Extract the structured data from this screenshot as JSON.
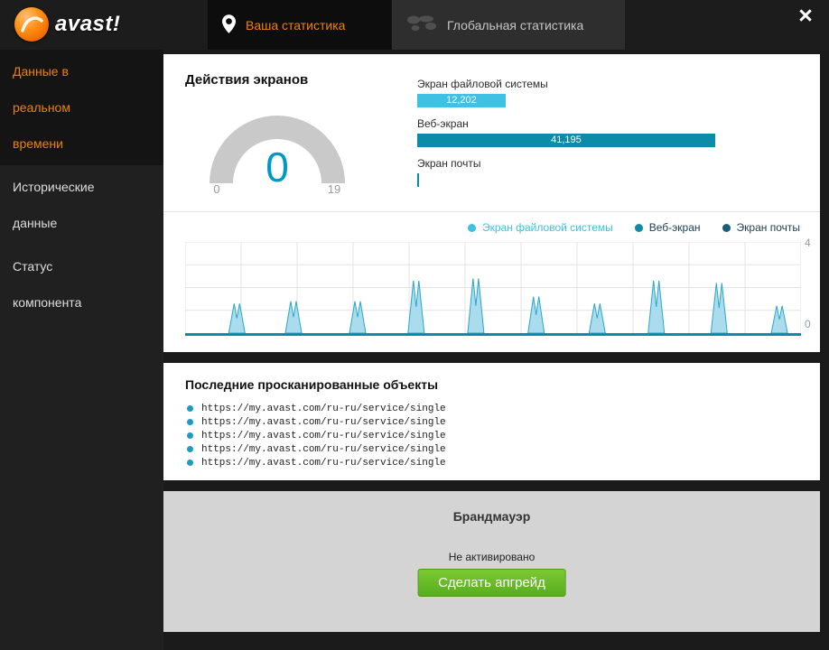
{
  "window": {
    "close": "×"
  },
  "logo": {
    "text": "avast!"
  },
  "tabs": [
    {
      "label": "Ваша статистика",
      "active": true
    },
    {
      "label": "Глобальная статистика",
      "active": false
    }
  ],
  "sidebar": {
    "items": [
      {
        "label": "Данные в реальном времени",
        "active": true
      },
      {
        "label": "Исторические данные",
        "active": false
      },
      {
        "label": "Статус компонента",
        "active": false
      }
    ]
  },
  "screen_actions": {
    "title": "Действия экранов",
    "gauge": {
      "value": "0",
      "min_label": "0",
      "max_label": "19"
    },
    "bars": [
      {
        "label": "Экран файловой системы",
        "value": "12,202",
        "color": "#3fc1e3",
        "width_pct": 23.1
      },
      {
        "label": "Веб-экран",
        "value": "41,195",
        "color": "#0d8ca9",
        "width_pct": 77.8
      },
      {
        "label": "Экран почты",
        "value": "",
        "color": "#0d8ca9",
        "width_pct": 0.5
      }
    ]
  },
  "chart_data": {
    "type": "area",
    "title": "",
    "legend": [
      {
        "label": "Экран файловой системы",
        "color": "#3fc1e3",
        "text_color": "#3fc1e3"
      },
      {
        "label": "Веб-экран",
        "color": "#0d8ca9",
        "text_color": "#1c3e50"
      },
      {
        "label": "Экран почты",
        "color": "#1d5c7d",
        "text_color": "#1c3e50"
      }
    ],
    "ylim": [
      0,
      4
    ],
    "y_axis_labels": {
      "top": "4",
      "bottom": "0"
    },
    "x": [
      0.084,
      0.176,
      0.28,
      0.375,
      0.472,
      0.57,
      0.669,
      0.765,
      0.867,
      0.965
    ],
    "values": [
      1.3,
      1.4,
      1.4,
      2.3,
      2.4,
      1.6,
      1.3,
      2.3,
      2.2,
      1.2
    ],
    "grid": true,
    "baseline_color": "#0d8ca9",
    "fill_color": "#aadcee",
    "stroke_color": "#2aa7c9"
  },
  "scanned": {
    "title": "Последние просканированные объекты",
    "items": [
      "https://my.avast.com/ru-ru/service/single",
      "https://my.avast.com/ru-ru/service/single",
      "https://my.avast.com/ru-ru/service/single",
      "https://my.avast.com/ru-ru/service/single",
      "https://my.avast.com/ru-ru/service/single"
    ]
  },
  "firewall": {
    "title": "Брандмауэр",
    "status": "Не активировано",
    "button": "Сделать апгрейд",
    "button_color": "#5eb828"
  }
}
